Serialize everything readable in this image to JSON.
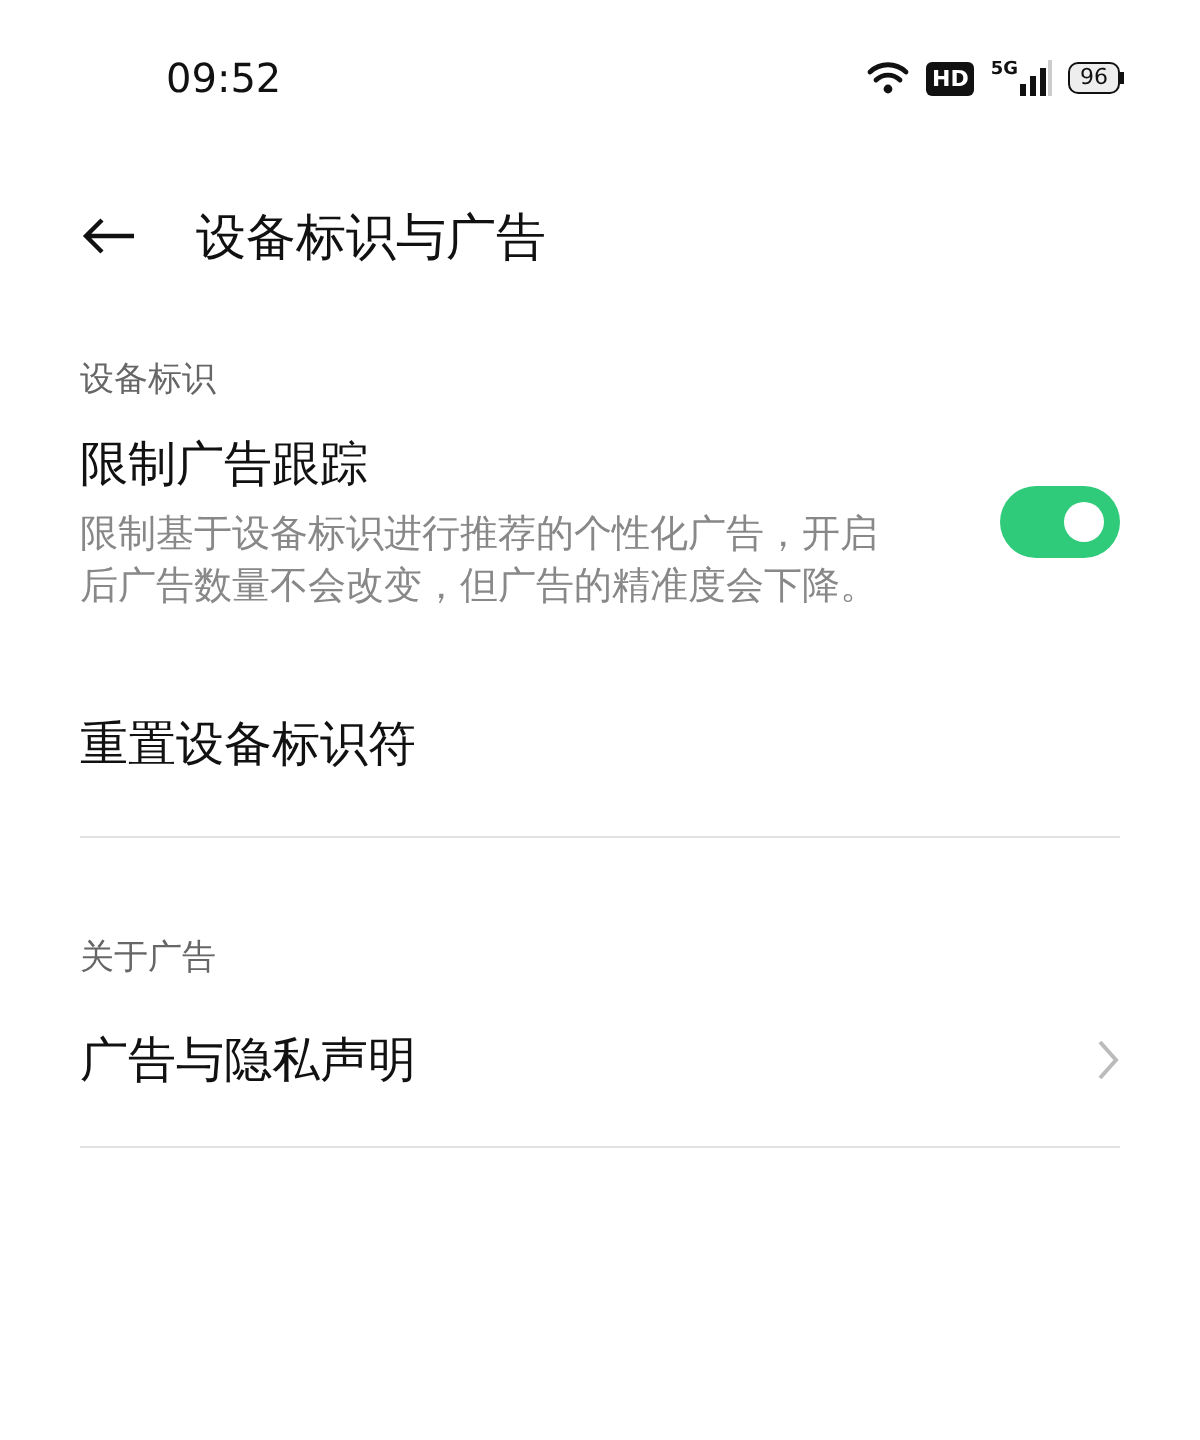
{
  "status_bar": {
    "time": "09:52",
    "hd": "HD",
    "network": "5G",
    "battery": "96"
  },
  "header": {
    "title": "设备标识与广告"
  },
  "sections": [
    {
      "title": "设备标识",
      "items": [
        {
          "kind": "toggle",
          "label": "限制广告跟踪",
          "description": "限制基于设备标识进行推荐的个性化广告，开启后广告数量不会改变，但广告的精准度会下降。",
          "on": true
        },
        {
          "kind": "action",
          "label": "重置设备标识符"
        }
      ]
    },
    {
      "title": "关于广告",
      "items": [
        {
          "kind": "link",
          "label": "广告与隐私声明"
        }
      ]
    }
  ]
}
